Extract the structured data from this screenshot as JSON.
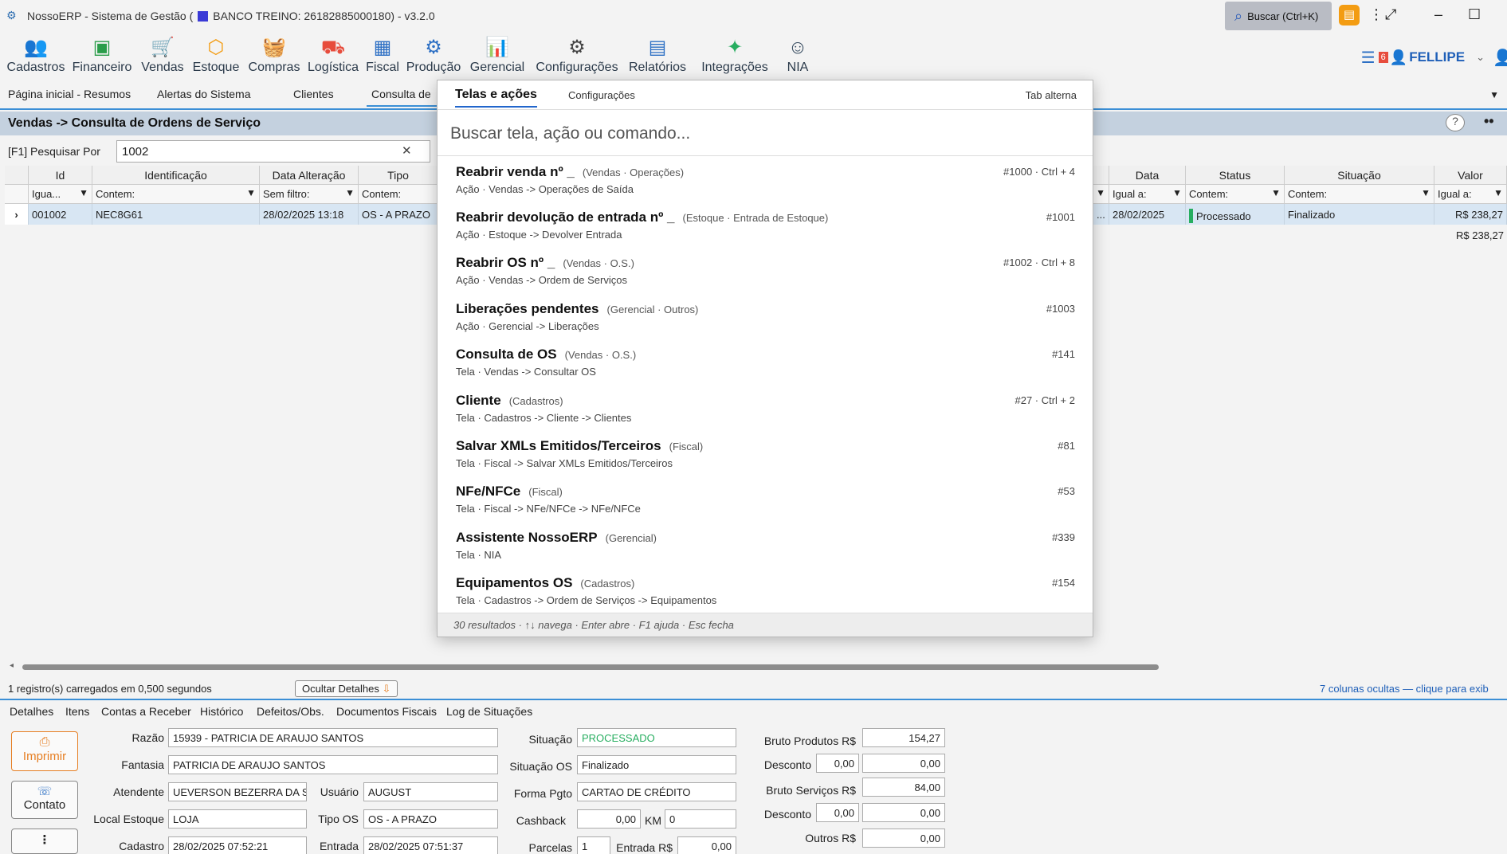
{
  "window": {
    "title_prefix": "NossoERP - Sistema de Gestão (",
    "database": "BANCO TREINO: 26182885000180) - v3.2.0",
    "search_button": "Buscar (Ctrl+K)"
  },
  "ribbon": [
    {
      "label": "Cadastros",
      "icon": "people-icon"
    },
    {
      "label": "Financeiro",
      "icon": "wallet-icon"
    },
    {
      "label": "Vendas",
      "icon": "cart-icon"
    },
    {
      "label": "Estoque",
      "icon": "box-icon"
    },
    {
      "label": "Compras",
      "icon": "basket-icon"
    },
    {
      "label": "Logística",
      "icon": "truck-icon"
    },
    {
      "label": "Fiscal",
      "icon": "document-icon"
    },
    {
      "label": "Produção",
      "icon": "factory-icon"
    },
    {
      "label": "Gerencial",
      "icon": "chart-icon"
    },
    {
      "label": "Configurações",
      "icon": "gear-icon"
    },
    {
      "label": "Relatórios",
      "icon": "report-icon"
    },
    {
      "label": "Integrações",
      "icon": "puzzle-icon"
    },
    {
      "label": "NIA",
      "icon": "robot-icon"
    }
  ],
  "user": {
    "name": "FELLIPE",
    "badge": "6"
  },
  "doc_tabs": [
    "Página inicial - Resumos",
    "Alertas do Sistema",
    "Clientes",
    "Consulta de"
  ],
  "breadcrumb": "Vendas -> Consulta de Ordens de Serviço",
  "search": {
    "label": "[F1] Pesquisar Por",
    "value": "1002"
  },
  "grid": {
    "columns_left": [
      {
        "header": "Id",
        "filter": "Igua..."
      },
      {
        "header": "Identificação",
        "filter": "Contem:"
      },
      {
        "header": "Data Alteração",
        "filter": "Sem filtro:"
      },
      {
        "header": "Tipo",
        "filter": "Contem:"
      }
    ],
    "columns_right": [
      {
        "header": "Data",
        "filter": "Igual a:"
      },
      {
        "header": "Status",
        "filter": "Contem:"
      },
      {
        "header": "Situação",
        "filter": "Contem:"
      },
      {
        "header": "Valor",
        "filter": "Igual a:"
      }
    ],
    "row": {
      "id": "001002",
      "identificacao": "NEC8G61",
      "data_alteracao": "28/02/2025 13:18",
      "tipo": "OS - A PRAZO",
      "ellipsis": "...",
      "data": "28/02/2025",
      "status": "Processado",
      "situacao": "Finalizado",
      "valor": "R$ 238,27"
    },
    "total": "R$ 238,27"
  },
  "status": {
    "message": "1 registro(s) carregados em 0,500 segundos",
    "hide_details": "Ocultar Detalhes",
    "hidden_columns": "7 colunas ocultas — clique para exib"
  },
  "detail_tabs": [
    "Detalhes",
    "Itens",
    "Contas a Receber",
    "Histórico",
    "Defeitos/Obs.",
    "Documentos Fiscais",
    "Log de Situações"
  ],
  "detail": {
    "print": "Imprimir",
    "contact": "Contato",
    "more": "⋮",
    "razao_label": "Razão",
    "razao": "15939 - PATRICIA DE ARAUJO SANTOS",
    "fantasia_label": "Fantasia",
    "fantasia": "PATRICIA DE ARAUJO SANTOS",
    "atendente_label": "Atendente",
    "atendente": "UEVERSON BEZERRA DA S",
    "usuario_label": "Usuário",
    "usuario": "AUGUST",
    "local_label": "Local Estoque",
    "local": "LOJA",
    "tipo_os_label": "Tipo OS",
    "tipo_os": "OS - A PRAZO",
    "cadastro_label": "Cadastro",
    "cadastro": "28/02/2025 07:52:21",
    "entrada_label": "Entrada",
    "entrada": "28/02/2025 07:51:37",
    "situacao_label": "Situação",
    "situacao": "PROCESSADO",
    "situacao_os_label": "Situação OS",
    "situacao_os": "Finalizado",
    "forma_label": "Forma Pgto",
    "forma": "CARTAO DE CRÉDITO",
    "cashback_label": "Cashback",
    "cashback": "0,00",
    "km_label": "KM",
    "km": "0",
    "parcelas_label": "Parcelas",
    "parcelas": "1",
    "entrada_rs_label": "Entrada R$",
    "entrada_rs": "0,00",
    "bruto_prod_label": "Bruto Produtos R$",
    "bruto_prod": "154,27",
    "desconto1_label": "Desconto",
    "desconto1_pct": "0,00",
    "desconto1": "0,00",
    "bruto_serv_label": "Bruto Serviços R$",
    "bruto_serv": "84,00",
    "desconto2_label": "Desconto",
    "desconto2_pct": "0,00",
    "desconto2": "0,00",
    "outros_label": "Outros R$",
    "outros": "0,00"
  },
  "palette": {
    "tab_active": "Telas e ações",
    "tab_other": "Configurações",
    "alt": "Tab alterna",
    "placeholder": "Buscar tela, ação ou comando...",
    "items": [
      {
        "title": "Reabrir venda nº _",
        "cat": "(Vendas · Operações)",
        "sub": "Ação  ·  Vendas -> Operações de Saída",
        "key": "#1000 · Ctrl + 4"
      },
      {
        "title": "Reabrir devolução de entrada nº _",
        "cat": "(Estoque · Entrada de Estoque)",
        "sub": "Ação  ·  Estoque -> Devolver Entrada",
        "key": "#1001"
      },
      {
        "title": "Reabrir OS nº _",
        "cat": "(Vendas · O.S.)",
        "sub": "Ação  ·  Vendas -> Ordem de Serviços",
        "key": "#1002 · Ctrl + 8"
      },
      {
        "title": "Liberações pendentes",
        "cat": "(Gerencial · Outros)",
        "sub": "Ação  ·  Gerencial -> Liberações",
        "key": "#1003"
      },
      {
        "title": "Consulta de OS",
        "cat": "(Vendas · O.S.)",
        "sub": "Tela  ·  Vendas -> Consultar OS",
        "key": "#141"
      },
      {
        "title": "Cliente",
        "cat": "(Cadastros)",
        "sub": "Tela  ·  Cadastros -> Cliente -> Clientes",
        "key": "#27 · Ctrl + 2"
      },
      {
        "title": "Salvar XMLs Emitidos/Terceiros",
        "cat": "(Fiscal)",
        "sub": "Tela  ·  Fiscal -> Salvar XMLs Emitidos/Terceiros",
        "key": "#81"
      },
      {
        "title": "NFe/NFCe",
        "cat": "(Fiscal)",
        "sub": "Tela  ·  Fiscal -> NFe/NFCe -> NFe/NFCe",
        "key": "#53"
      },
      {
        "title": "Assistente NossoERP",
        "cat": "(Gerencial)",
        "sub": "Tela  ·  NIA",
        "key": "#339"
      },
      {
        "title": "Equipamentos OS",
        "cat": "(Cadastros)",
        "sub": "Tela  ·  Cadastros -> Ordem de Serviços -> Equipamentos",
        "key": "#154"
      }
    ],
    "footer": "30 resultados  ·  ↑↓ navega  ·  Enter abre  ·  F1 ajuda  ·  Esc fecha"
  }
}
